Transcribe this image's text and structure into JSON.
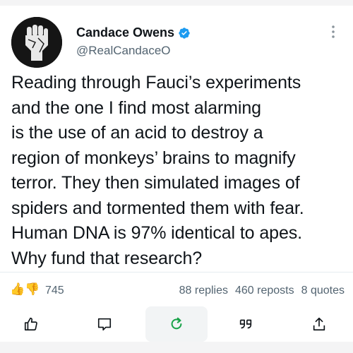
{
  "author": {
    "display_name": "Candace Owens",
    "handle": "@RealCandaceO",
    "avatar_icon": "raised-fist-icon",
    "verified_color": "#1d9bf0"
  },
  "tweet": {
    "text": "Reading through Fauci’s experiments\nand the one I find most alarming\nis the use of an acid to destroy a\nregion of monkeys’ brains to magnify\nterror. They then simulated images of\nspiders and tormented them with fear.\nHuman DNA is 97% identical to apes.\nWhy fund that research?"
  },
  "stats": {
    "reaction_emojis": "👍👎",
    "reactions_count": "745",
    "replies": "88 replies",
    "reposts": "460 reposts",
    "quotes": "8 quotes"
  },
  "actions": [
    {
      "name": "like",
      "icon": "thumbs-up-icon"
    },
    {
      "name": "comment",
      "icon": "comment-icon"
    },
    {
      "name": "repost",
      "icon": "refresh-icon",
      "color": "#1aa34a"
    },
    {
      "name": "quote",
      "icon": "quote-icon"
    },
    {
      "name": "share",
      "icon": "share-icon"
    }
  ]
}
